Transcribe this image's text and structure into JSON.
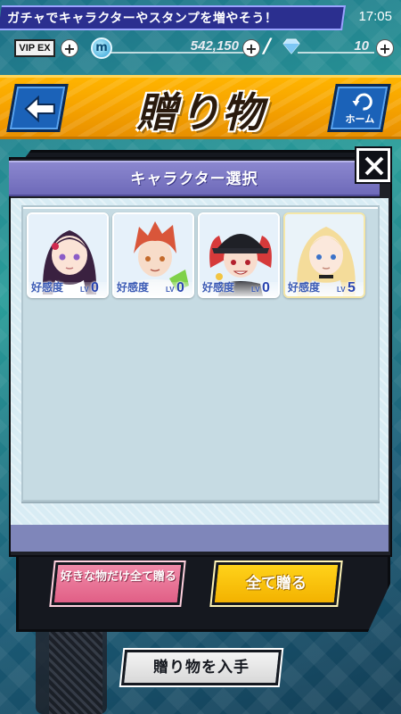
{
  "status": {
    "banner_text": "ガチャでキャラクターやスタンプを増やそう！",
    "clock": "17:05"
  },
  "currency": {
    "vip_label": "VIP EX",
    "coin_icon_label": "m",
    "coins": "542,150",
    "gems": "10"
  },
  "header": {
    "title": "贈り物",
    "home_label": "ホーム"
  },
  "modal": {
    "title": "キャラクター選択",
    "characters": [
      {
        "affinity_label": "好感度",
        "lv_label": "LV",
        "level": "0",
        "hair_color": "#3a2140",
        "bg_color": "#e6f1fa",
        "skin": "#fbe3d6",
        "eye": "#8b5cc7"
      },
      {
        "affinity_label": "好感度",
        "lv_label": "LV",
        "level": "0",
        "hair_color": "#d9563a",
        "bg_color": "#e6f1fa",
        "skin": "#f7dcc9",
        "eye": "#c46a2b"
      },
      {
        "affinity_label": "好感度",
        "lv_label": "LV",
        "level": "0",
        "hair_color": "#d63a3a",
        "bg_color": "#e6f1fa",
        "skin": "#f8dccd",
        "eye": "#b3202e"
      },
      {
        "affinity_label": "好感度",
        "lv_label": "LV",
        "level": "5",
        "hair_color": "#f4dc9a",
        "bg_color": "#eaf3f9",
        "skin": "#fbe8dc",
        "eye": "#3b72c9"
      }
    ]
  },
  "buttons": {
    "liked_only": "好きな物だけ全て贈る",
    "give_all": "全て贈る",
    "obtain_gifts": "贈り物を入手"
  },
  "colors": {
    "header_gold": "#f6a300",
    "modal_header": "#7a76c4",
    "nav_blue": "#1b62b8",
    "pink_button": "#e15f86",
    "yellow_button": "#f3b200"
  }
}
